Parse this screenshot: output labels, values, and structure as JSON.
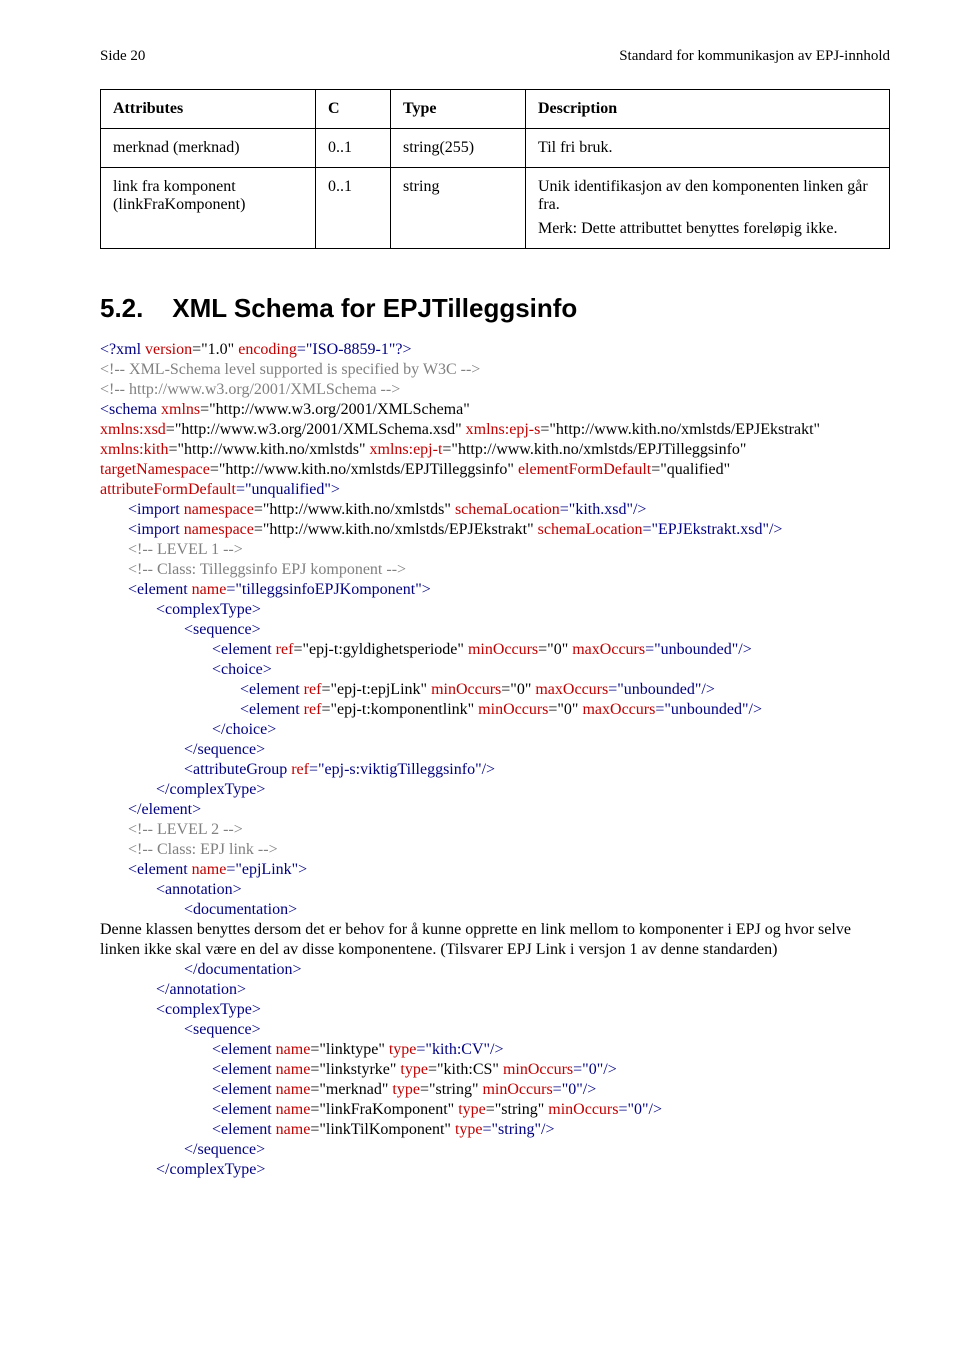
{
  "header": {
    "left": "Side 20",
    "right": "Standard for kommunikasjon av EPJ-innhold"
  },
  "table": {
    "headers": {
      "attributes": "Attributes",
      "c": "C",
      "type": "Type",
      "desc": "Description"
    },
    "rows": [
      {
        "attr": "merknad (merknad)",
        "c": "0..1",
        "type": "string(255)",
        "desc": "Til fri bruk."
      },
      {
        "attr": "link fra komponent (linkFraKomponent)",
        "c": "0..1",
        "type": "string",
        "desc1": "Unik identifikasjon av den komponenten linken går fra.",
        "desc2": "Merk: Dette attributtet benyttes foreløpig ikke."
      }
    ]
  },
  "section": {
    "number": "5.2.",
    "title": "XML Schema for EPJTilleggsinfo"
  },
  "xml": {
    "l01_a": "<?",
    "l01_b": "xml",
    "l01_c": " version",
    "l01_d": "=\"1.0\"",
    "l01_e": " encoding",
    "l01_f": "=\"ISO-8859-1\"?>",
    "c1": "<!-- XML-Schema level supported is specified by W3C -->",
    "c2": "<!-- http://www.w3.org/2001/XMLSchema -->",
    "s_open": "<schema",
    "s_xmlns_n": " xmlns",
    "s_xmlns_v": "=\"http://www.w3.org/2001/XMLSchema\"",
    "s_xsd_n": "xmlns:xsd",
    "s_xsd_v": "=\"http://www.w3.org/2001/XMLSchema.xsd\"",
    "s_epjs_n": " xmlns:epj-s",
    "s_epjs_v": "=\"http://www.kith.no/xmlstds/EPJEkstrakt\"",
    "s_kith_n": "xmlns:kith",
    "s_kith_v": "=\"http://www.kith.no/xmlstds\"",
    "s_epjt_n": " xmlns:epj-t",
    "s_epjt_v": "=\"http://www.kith.no/xmlstds/EPJTilleggsinfo\"",
    "s_tns_n": "targetNamespace",
    "s_tns_v": "=\"http://www.kith.no/xmlstds/EPJTilleggsinfo\"",
    "s_efd_n": " elementFormDefault",
    "s_efd_v": "=\"qualified\"",
    "s_afd_n": "attributeFormDefault",
    "s_afd_v": "=\"unqualified\">",
    "imp1_a": "<import",
    "imp1_ns_n": " namespace",
    "imp1_ns_v": "=\"http://www.kith.no/xmlstds\"",
    "imp1_sl_n": " schemaLocation",
    "imp1_sl_v": "=\"kith.xsd\"/>",
    "imp2_a": "<import",
    "imp2_ns_n": " namespace",
    "imp2_ns_v": "=\"http://www.kith.no/xmlstds/EPJEkstrakt\"",
    "imp2_sl_n": " schemaLocation",
    "imp2_sl_v": "=\"EPJEkstrakt.xsd\"/>",
    "c3": "<!-- LEVEL 1 -->",
    "c4": "<!-- Class: Tilleggsinfo EPJ komponent -->",
    "e1_o": "<element",
    "e1_nn": " name",
    "e1_nv": "=\"tilleggsinfoEPJKomponent\">",
    "ct_o": "<complexType>",
    "seq_o": "<sequence>",
    "e2_o": "<element",
    "e2_rn": " ref",
    "e2_rv": "=\"epj-t:gyldighetsperiode\"",
    "mo_n": " minOccurs",
    "mo0": "=\"0\"",
    "mx_n": " maxOccurs",
    "mx_unb": "=\"unbounded\"/>",
    "ch_o": "<choice>",
    "e3_o": "<element",
    "e3_rn": " ref",
    "e3_rv": "=\"epj-t:epjLink\"",
    "e4_o": "<element",
    "e4_rn": " ref",
    "e4_rv": "=\"epj-t:komponentlink\"",
    "ch_c": "</choice>",
    "seq_c": "</sequence>",
    "ag_o": "<attributeGroup",
    "ag_rn": " ref",
    "ag_rv": "=\"epj-s:viktigTilleggsinfo\"/>",
    "ct_c": "</complexType>",
    "e_c": "</element>",
    "c5": "<!-- LEVEL 2 -->",
    "c6": "<!-- Class: EPJ link -->",
    "e5_o": "<element",
    "e5_nn": " name",
    "e5_nv": "=\"epjLink\">",
    "ann_o": "<annotation>",
    "doc_o": "<documentation>",
    "doctext": "Denne klassen benyttes dersom det er behov for å kunne opprette en link mellom to komponenter i EPJ og hvor selve linken ikke skal være en del av disse komponentene.   (Tilsvarer EPJ Link i versjon 1 av denne standarden)",
    "doc_c": "</documentation>",
    "ann_c": "</annotation>",
    "e6_o": "<element",
    "e6_nn": " name",
    "e6_nv": "=\"linktype\"",
    "e6_tn": " type",
    "e6_tv": "=\"kith:CV\"/>",
    "e7_o": "<element",
    "e7_nn": " name",
    "e7_nv": "=\"linkstyrke\"",
    "e7_tn": " type",
    "e7_tv": "=\"kith:CS\"",
    "mo_close": "=\"0\"/>",
    "e8_o": "<element",
    "e8_nn": " name",
    "e8_nv": "=\"merknad\"",
    "e8_tn": " type",
    "e8_tv": "=\"string\"",
    "e9_o": "<element",
    "e9_nn": " name",
    "e9_nv": "=\"linkFraKomponent\"",
    "e9_tn": " type",
    "e9_tv": "=\"string\"",
    "e10_o": "<element",
    "e10_nn": " name",
    "e10_nv": "=\"linkTilKomponent\"",
    "e10_tn": " type",
    "e10_tv": "=\"string\"/>"
  }
}
